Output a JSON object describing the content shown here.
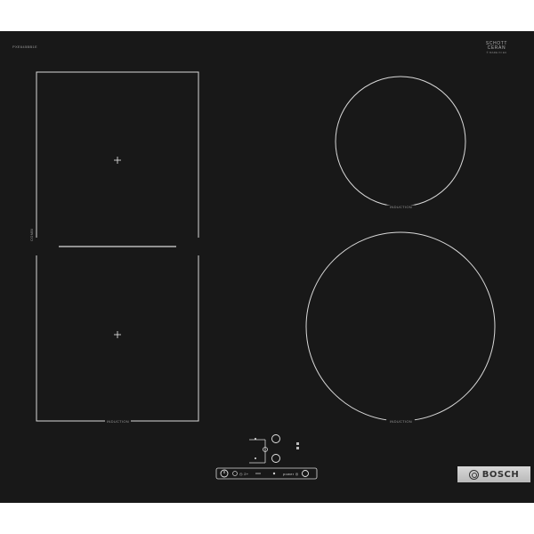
{
  "hob": {
    "model_label": "PXE645BB1E",
    "glass_brand_line1": "SCHOTT",
    "glass_brand_line2": "CERAN",
    "glass_brand_sub": "®  MADE IN EU",
    "zones": [
      {
        "label": "INDUCTION"
      },
      {
        "label": "INDUCTION"
      },
      {
        "label": "INDUCTION"
      }
    ],
    "combi_label": "COMBI",
    "brand": "BOSCH"
  },
  "controls": {
    "timer_label": "◷ 2+",
    "power_label": "power ◎",
    "minus_label": "—",
    "plus_label": "+"
  },
  "colors": {
    "glass": "#181818",
    "markings": "#d9d9d9",
    "brand_plate": "#c8c8c8"
  }
}
